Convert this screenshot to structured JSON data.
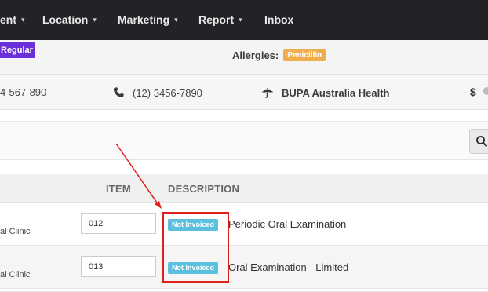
{
  "nav": {
    "items": [
      {
        "label": "ent",
        "caret": "▾"
      },
      {
        "label": "Location",
        "caret": "▾"
      },
      {
        "label": "Marketing",
        "caret": "▾"
      },
      {
        "label": "Report",
        "caret": "▾"
      },
      {
        "label": "Inbox",
        "caret": ""
      }
    ]
  },
  "patient": {
    "type_badge": "Regular",
    "allergies_label": "Allergies:",
    "allergy": "Penicillin",
    "phone1": "4-567-890",
    "phone2": "(12) 3456-7890",
    "insurer": "BUPA Australia Health",
    "currency_symbol": "$"
  },
  "table": {
    "headers": {
      "item": "ITEM",
      "description": "DESCRIPTION"
    },
    "rows": [
      {
        "clinic": "al Clinic",
        "item": "012",
        "status": "Not Invoiced",
        "description": "Periodic Oral Examination"
      },
      {
        "clinic": "al Clinic",
        "item": "013",
        "status": "Not Invoiced",
        "description": "Oral Examination - Limited"
      }
    ]
  },
  "colors": {
    "nav_bg": "#222327",
    "regular_badge": "#6b2fd8",
    "allergy_badge": "#f0ad4e",
    "status_badge": "#5bc0de",
    "annotation": "#e0201b"
  },
  "icons": {
    "phone": "phone-icon",
    "umbrella": "umbrella-icon",
    "search": "search-icon"
  }
}
